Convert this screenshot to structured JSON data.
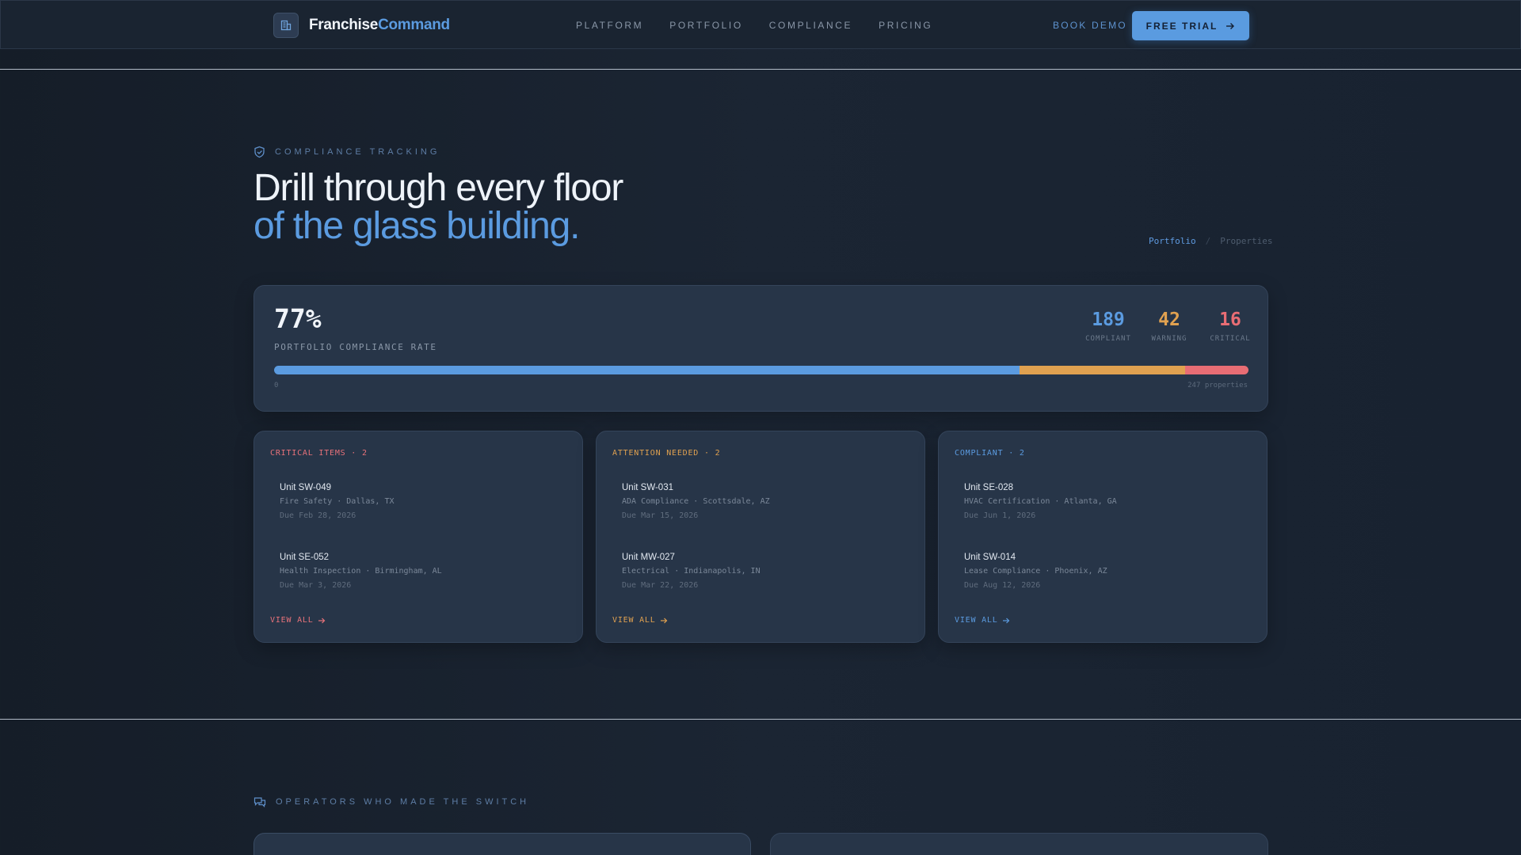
{
  "brand": {
    "name_a": "Franchise",
    "name_b": "Command"
  },
  "nav": {
    "items": [
      "PLATFORM",
      "PORTFOLIO",
      "COMPLIANCE",
      "PRICING"
    ],
    "book_demo": "BOOK DEMO",
    "free_trial": "FREE TRIAL"
  },
  "hero": {
    "eyebrow": "COMPLIANCE TRACKING",
    "title_line1": "Drill through every floor",
    "title_line2": "of the glass building.",
    "breadcrumb": {
      "current": "Portfolio",
      "next": "Properties"
    }
  },
  "summary": {
    "rate": "77%",
    "rate_label": "PORTFOLIO COMPLIANCE RATE",
    "compliant": {
      "value": "189",
      "label": "COMPLIANT",
      "color": "#5b9be0"
    },
    "warning": {
      "value": "42",
      "label": "WARNING",
      "color": "#e0a150"
    },
    "critical": {
      "value": "16",
      "label": "CRITICAL",
      "color": "#e86d74"
    },
    "bar_min": "0",
    "bar_max": "247 properties",
    "segments": {
      "compliant": 189,
      "warning": 42,
      "critical": 16
    }
  },
  "columns": [
    {
      "title": "CRITICAL ITEMS · 2",
      "color": "#e8727a",
      "items": [
        {
          "unit": "Unit SW-049",
          "desc": "Fire Safety · Dallas, TX",
          "due": "Due Feb 28, 2026"
        },
        {
          "unit": "Unit SE-052",
          "desc": "Health Inspection · Birmingham, AL",
          "due": "Due Mar 3, 2026"
        }
      ],
      "view_all": "VIEW ALL"
    },
    {
      "title": "ATTENTION NEEDED · 2",
      "color": "#e0a150",
      "items": [
        {
          "unit": "Unit SW-031",
          "desc": "ADA Compliance · Scottsdale, AZ",
          "due": "Due Mar 15, 2026"
        },
        {
          "unit": "Unit MW-027",
          "desc": "Electrical · Indianapolis, IN",
          "due": "Due Mar 22, 2026"
        }
      ],
      "view_all": "VIEW ALL"
    },
    {
      "title": "COMPLIANT · 2",
      "color": "#5b9be0",
      "items": [
        {
          "unit": "Unit SE-028",
          "desc": "HVAC Certification · Atlanta, GA",
          "due": "Due Jun 1, 2026"
        },
        {
          "unit": "Unit SW-014",
          "desc": "Lease Compliance · Phoenix, AZ",
          "due": "Due Aug 12, 2026"
        }
      ],
      "view_all": "VIEW ALL"
    }
  ],
  "testimonials": {
    "eyebrow": "OPERATORS WHO MADE THE SWITCH"
  }
}
